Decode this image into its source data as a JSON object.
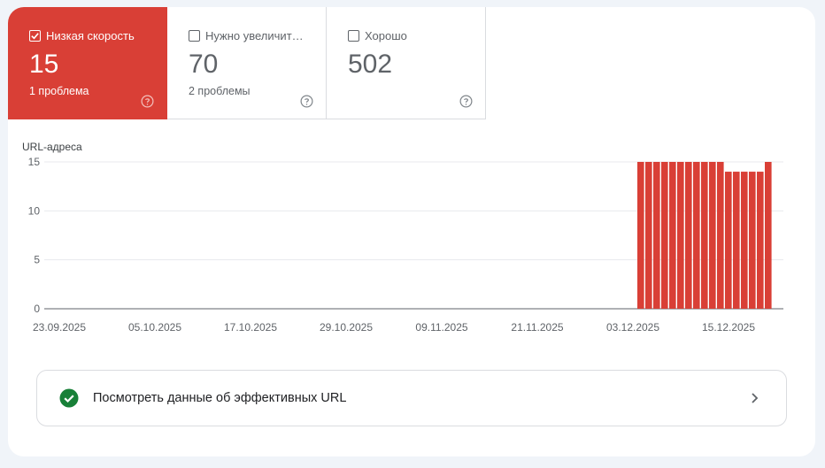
{
  "tabs": [
    {
      "label": "Низкая скорость",
      "count": "15",
      "issues": "1 проблема",
      "checked": true
    },
    {
      "label": "Нужно увеличит…",
      "count": "70",
      "issues": "2 проблемы",
      "checked": false
    },
    {
      "label": "Хорошо",
      "count": "502",
      "issues": "",
      "checked": false
    }
  ],
  "colors": {
    "poor": "#d93f36",
    "good": "#188038",
    "grid": "#e8eaed",
    "axis": "#5f6368"
  },
  "chart_data": {
    "type": "bar",
    "ylabel": "URL-адреса",
    "ylim": [
      0,
      15
    ],
    "yticks": [
      "0",
      "5",
      "10",
      "15"
    ],
    "xticks": [
      "23.09.2025",
      "05.10.2025",
      "17.10.2025",
      "29.10.2025",
      "09.11.2025",
      "21.11.2025",
      "03.12.2025",
      "15.12.2025"
    ],
    "series": [
      {
        "values": [
          15,
          15,
          15,
          15,
          15,
          15,
          15,
          15,
          15,
          15,
          15,
          14,
          14,
          14,
          14,
          14,
          15
        ]
      }
    ]
  },
  "link": {
    "label": "Посмотреть данные об эффективных URL"
  }
}
